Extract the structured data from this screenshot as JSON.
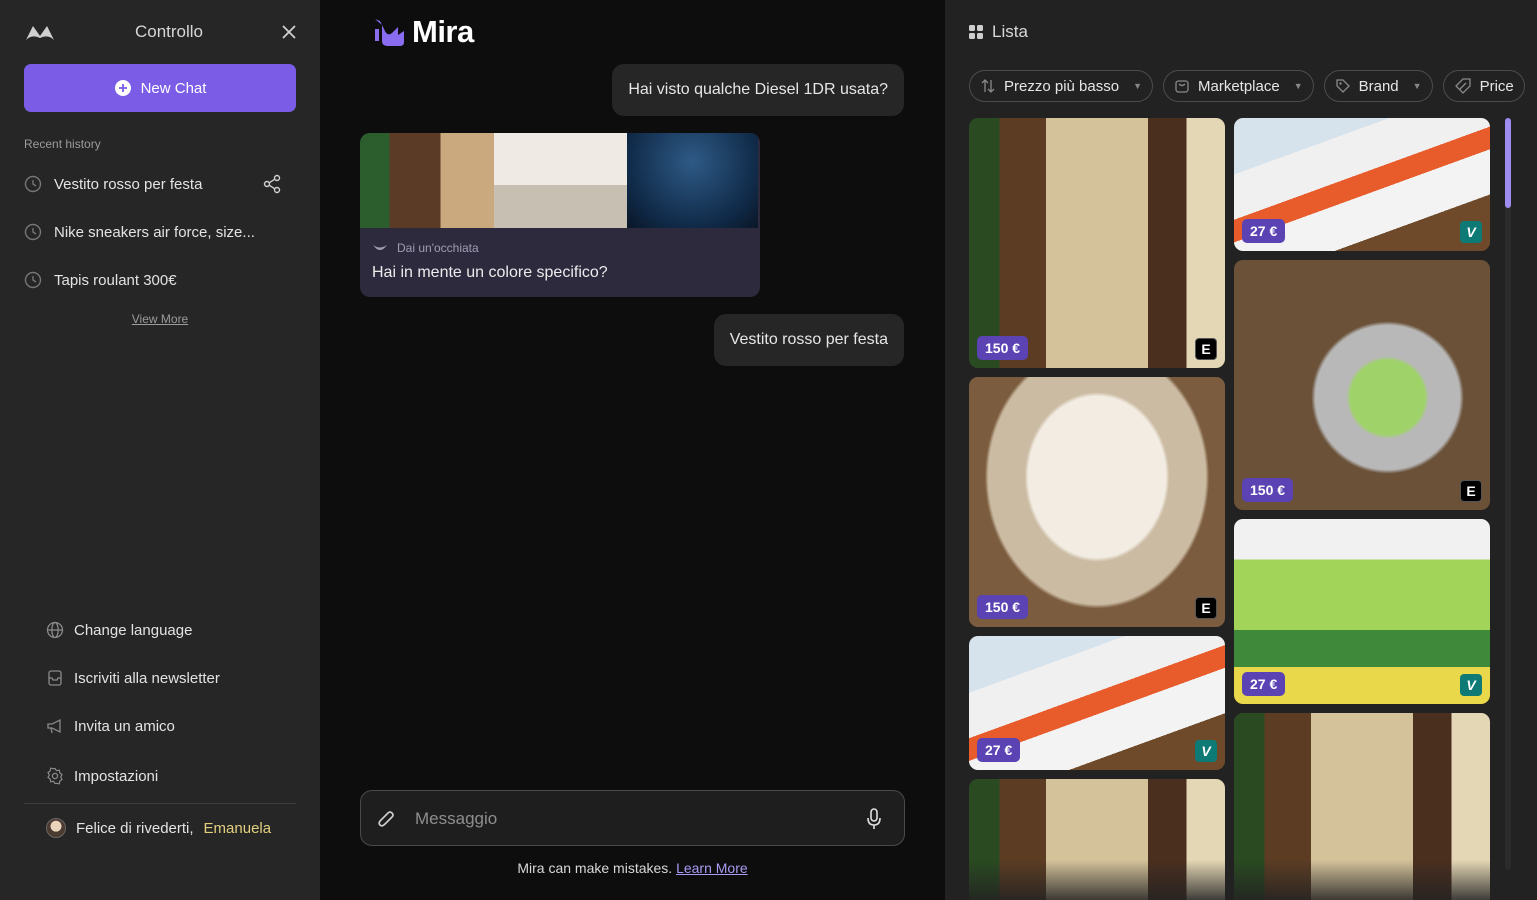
{
  "sidebar": {
    "title": "Controllo",
    "new_chat_label": "New Chat",
    "recent_label": "Recent history",
    "history": [
      {
        "label": "Vestito rosso per festa"
      },
      {
        "label": "Nike sneakers air force, size..."
      },
      {
        "label": "Tapis roulant 300€"
      }
    ],
    "view_more": "View More",
    "menu": [
      {
        "label": "Change language",
        "icon": "globe-icon"
      },
      {
        "label": "Iscriviti alla newsletter",
        "icon": "newsletter-icon"
      },
      {
        "label": "Invita un amico",
        "icon": "megaphone-icon"
      },
      {
        "label": "Impostazioni",
        "icon": "gear-icon"
      }
    ],
    "greeting": "Felice di rivederti,",
    "user_name": "Emanuela"
  },
  "chat": {
    "logo_text": "Mira",
    "messages": [
      {
        "role": "user",
        "text": "Hai visto qualche Diesel 1DR usata?"
      },
      {
        "role": "assistant",
        "subtitle": "Dai un'occhiata",
        "text": "Hai in mente un colore specifico?"
      },
      {
        "role": "user",
        "text": "Vestito rosso per festa"
      }
    ],
    "composer_placeholder": "Messaggio",
    "disclaimer": "Mira can make mistakes.",
    "learn_more": "Learn More"
  },
  "panel": {
    "title": "Lista",
    "filters": [
      {
        "label": "Prezzo più basso",
        "icon": "sort-icon"
      },
      {
        "label": "Marketplace",
        "icon": "bag-icon"
      },
      {
        "label": "Brand",
        "icon": "tag-icon"
      },
      {
        "label": "Price",
        "icon": "price-tag-icon"
      }
    ],
    "products": [
      {
        "price": "150 €",
        "marketplace": "E",
        "image": "cradle-room"
      },
      {
        "price": "150 €",
        "marketplace": "E",
        "image": "bassinet"
      },
      {
        "price": "27 €",
        "marketplace": "V",
        "image": "marble-track"
      },
      {
        "price": "",
        "marketplace": "",
        "image": "cradle-room"
      },
      {
        "price": "27 €",
        "marketplace": "V",
        "image": "marble-track"
      },
      {
        "price": "150 €",
        "marketplace": "E",
        "image": "baby-mobile"
      },
      {
        "price": "27 €",
        "marketplace": "V",
        "image": "baby-bouncer"
      },
      {
        "price": "",
        "marketplace": "",
        "image": "cradle-room"
      }
    ]
  },
  "colors": {
    "accent": "#7b5ce6",
    "price_badge": "#5b43b3",
    "sidebar_bg": "#262626",
    "chat_bg": "#0d0d0d",
    "panel_bg": "#222222",
    "vinted_badge": "#0d7a76",
    "greeting_name": "#e2cf7d"
  }
}
